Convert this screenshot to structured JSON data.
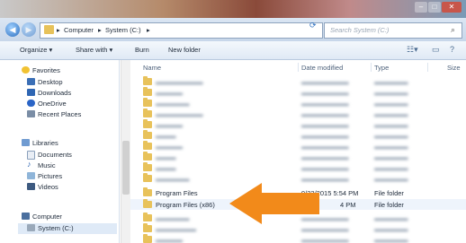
{
  "window": {
    "buttons": {
      "minimize": "–",
      "maximize": "□",
      "close": "✕"
    }
  },
  "address": {
    "crumbs": [
      "Computer",
      "System (C:)"
    ],
    "search_placeholder": "Search System (C:)"
  },
  "toolbar": {
    "organize": "Organize ▾",
    "share": "Share with ▾",
    "burn": "Burn",
    "new_folder": "New folder"
  },
  "sidebar": {
    "favorites": "Favorites",
    "desktop": "Desktop",
    "downloads": "Downloads",
    "onedrive": "OneDrive",
    "recent": "Recent Places",
    "libraries": "Libraries",
    "documents": "Documents",
    "music": "Music",
    "pictures": "Pictures",
    "videos": "Videos",
    "computer": "Computer",
    "system": "System (C:)"
  },
  "columns": {
    "name": "Name",
    "date": "Date modified",
    "type": "Type",
    "size": "Size"
  },
  "files": {
    "pf": {
      "name": "Program Files",
      "date": "9/22/2015 5:54 PM",
      "type": "File folder"
    },
    "pf86": {
      "name": "Program Files (x86)",
      "date": "4 PM",
      "type": "File folder"
    }
  },
  "colors": {
    "arrow": "#f28a1a",
    "folder": "#e8c25b"
  }
}
